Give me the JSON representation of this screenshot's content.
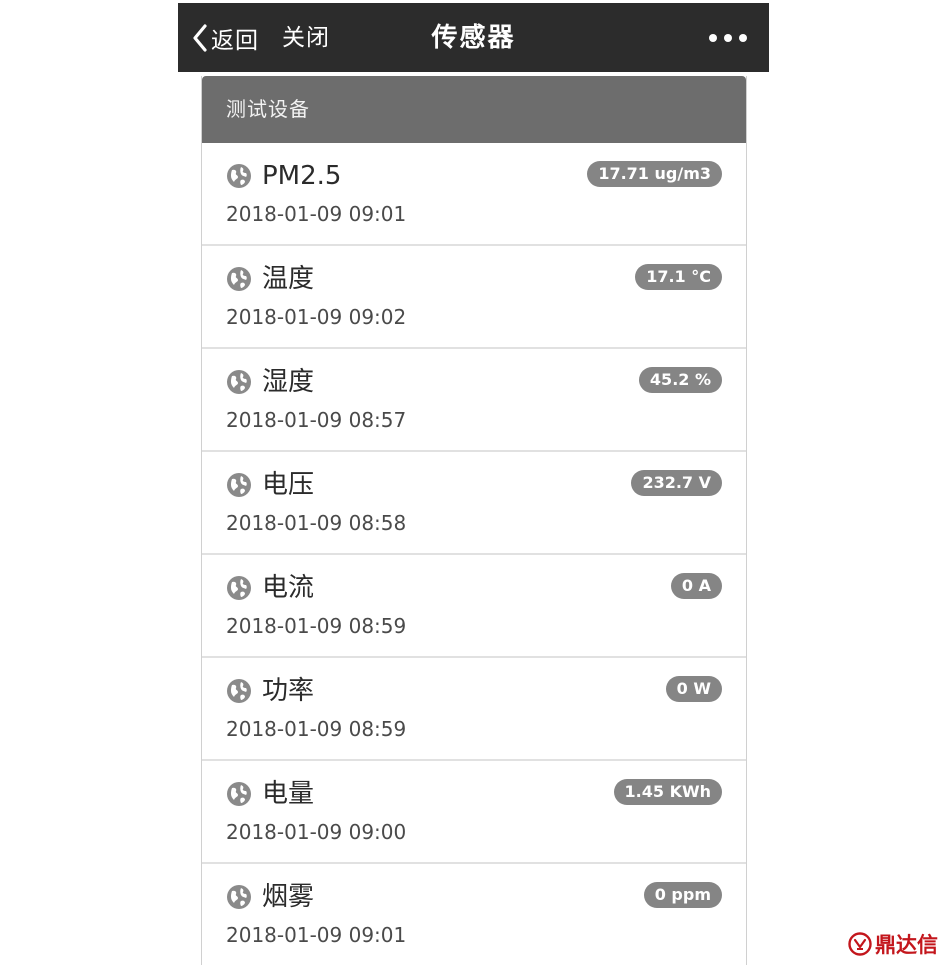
{
  "navbar": {
    "back_label": "返回",
    "close_label": "关闭",
    "title": "传感器",
    "more_icon": "more-dots-icon"
  },
  "card": {
    "header": "测试设备",
    "sensors": [
      {
        "name": "PM2.5",
        "time": "2018-01-09 09:01",
        "value": "17.71 ug/m3",
        "icon": "globe-icon"
      },
      {
        "name": "温度",
        "time": "2018-01-09 09:02",
        "value": "17.1 °C",
        "icon": "globe-icon"
      },
      {
        "name": "湿度",
        "time": "2018-01-09 08:57",
        "value": "45.2 %",
        "icon": "globe-icon"
      },
      {
        "name": "电压",
        "time": "2018-01-09 08:58",
        "value": "232.7 V",
        "icon": "globe-icon"
      },
      {
        "name": "电流",
        "time": "2018-01-09 08:59",
        "value": "0 A",
        "icon": "globe-icon"
      },
      {
        "name": "功率",
        "time": "2018-01-09 08:59",
        "value": "0 W",
        "icon": "globe-icon"
      },
      {
        "name": "电量",
        "time": "2018-01-09 09:00",
        "value": "1.45 KWh",
        "icon": "globe-icon"
      },
      {
        "name": "烟雾",
        "time": "2018-01-09 09:01",
        "value": "0 ppm",
        "icon": "globe-icon"
      }
    ]
  },
  "watermark": {
    "text": "鼎达信"
  },
  "colors": {
    "navbar_bg": "#2c2c2c",
    "card_header_bg": "#6d6d6d",
    "badge_bg": "#858585",
    "watermark": "#c3161c"
  }
}
